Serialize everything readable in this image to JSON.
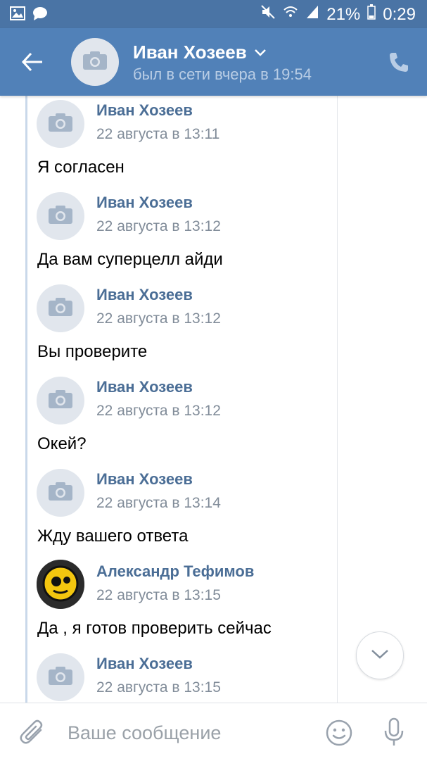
{
  "status_bar": {
    "battery": "21%",
    "time": "0:29",
    "icons": [
      "image-icon",
      "message-icon",
      "mute-icon",
      "wifi-icon",
      "signal-icon",
      "battery-icon"
    ]
  },
  "header": {
    "name": "Иван Хозеев",
    "status": "был в сети вчера в 19:54",
    "icons": [
      "back-arrow-icon",
      "camera-icon",
      "chevron-down-icon",
      "phone-icon"
    ]
  },
  "messages": [
    {
      "sender": "Иван Хозеев",
      "date": "22 августа в 13:11",
      "text": "Я согласен",
      "avatar": "camera-icon"
    },
    {
      "sender": "Иван Хозеев",
      "date": "22 августа в 13:12",
      "text": "Да вам суперцелл айди",
      "avatar": "camera-icon"
    },
    {
      "sender": "Иван Хозеев",
      "date": "22 августа в 13:12",
      "text": "Вы проверите",
      "avatar": "camera-icon"
    },
    {
      "sender": "Иван Хозеев",
      "date": "22 августа в 13:12",
      "text": "Окей?",
      "avatar": "camera-icon"
    },
    {
      "sender": "Иван Хозеев",
      "date": "22 августа в 13:14",
      "text": "Жду вашего ответа",
      "avatar": "camera-icon"
    },
    {
      "sender": "Александр Тефимов",
      "date": "22 августа в 13:15",
      "text": "Да , я готов проверить сейчас",
      "avatar": "brawl-stars-skull-icon"
    },
    {
      "sender": "Иван Хозеев",
      "date": "22 августа в 13:15",
      "text": "",
      "avatar": "camera-icon"
    }
  ],
  "composer": {
    "placeholder": "Ваше сообщение",
    "icons": [
      "paperclip-icon",
      "emoji-icon",
      "microphone-icon"
    ]
  },
  "colors": {
    "status_bar": "#4a74a5",
    "nav_bar": "#5181b8",
    "sender_name": "#4b6e96",
    "date": "#818c99",
    "quote_bar": "#c9d8ea"
  }
}
